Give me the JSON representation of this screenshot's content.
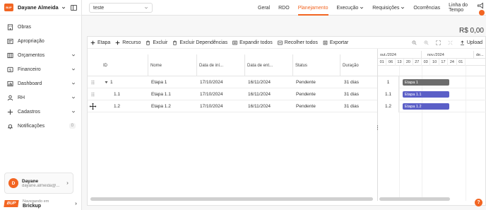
{
  "sidebar": {
    "user_name": "Dayane Almeida",
    "items": [
      {
        "label": "Obras",
        "icon": "building-icon",
        "has_chevron": false
      },
      {
        "label": "Apropriação",
        "icon": "document-icon",
        "has_chevron": false
      },
      {
        "label": "Orçamentos",
        "icon": "table-icon",
        "has_chevron": true
      },
      {
        "label": "Financeiro",
        "icon": "dollar-icon",
        "has_chevron": true
      },
      {
        "label": "Dashboard",
        "icon": "chart-icon",
        "has_chevron": true
      },
      {
        "label": "RH",
        "icon": "user-icon",
        "has_chevron": true
      },
      {
        "label": "Cadastros",
        "icon": "plus-icon",
        "has_chevron": true
      },
      {
        "label": "Notificações",
        "icon": "bell-icon",
        "badge": "0"
      }
    ],
    "profile": {
      "name": "Dayane",
      "email": "dayane.almeida@...",
      "initial": "D"
    },
    "footer": {
      "caption": "Navegando em",
      "company": "Brickup",
      "logo_text": "BUP"
    }
  },
  "topbar": {
    "project": "teste",
    "tabs": [
      {
        "label": "Geral",
        "active": false,
        "dropdown": false
      },
      {
        "label": "RDO",
        "active": false,
        "dropdown": false
      },
      {
        "label": "Planejamento",
        "active": true,
        "dropdown": false
      },
      {
        "label": "Execução",
        "active": false,
        "dropdown": true
      },
      {
        "label": "Requisições",
        "active": false,
        "dropdown": true
      },
      {
        "label": "Ocorrências",
        "active": false,
        "dropdown": false
      },
      {
        "label": "Linha do Tempo",
        "active": false,
        "dropdown": false
      }
    ]
  },
  "total": "R$ 0,00",
  "toolbar": {
    "buttons": [
      "Etapa",
      "Recurso",
      "Excluir",
      "Excluir Dependências",
      "Expandir todos",
      "Recolher todos",
      "Exportar"
    ],
    "upload": "Upload"
  },
  "grid": {
    "columns": [
      "ID",
      "Nome",
      "Data de iní...",
      "Data de ent...",
      "Status",
      "Duração"
    ],
    "rows": [
      {
        "id": "1",
        "name": "Etapa 1",
        "start": "17/10/2024",
        "end": "16/11/2024",
        "status": "Pendente",
        "duration": "31 dias"
      },
      {
        "id": "1.1",
        "name": "Etapa 1.1",
        "start": "17/10/2024",
        "end": "16/11/2024",
        "status": "Pendente",
        "duration": "31 dias"
      },
      {
        "id": "1.2",
        "name": "Etapa 1.2",
        "start": "17/10/2024",
        "end": "16/11/2024",
        "status": "Pendente",
        "duration": "31 dias"
      }
    ]
  },
  "gantt": {
    "months": [
      "out./2024",
      "nov./2024",
      "de..."
    ],
    "days": [
      "01",
      "06",
      "13",
      "20",
      "27",
      "03",
      "10",
      "17",
      "24",
      "01"
    ],
    "ids": [
      "1",
      "1.1",
      "1.2"
    ],
    "bars": [
      {
        "label": "Etapa 1",
        "color": "#6b6b6b"
      },
      {
        "label": "Etapa 1.1",
        "color": "#5b5fc7"
      },
      {
        "label": "Etapa 1.2",
        "color": "#5b5fc7"
      }
    ]
  },
  "colors": {
    "accent": "#f26522"
  }
}
